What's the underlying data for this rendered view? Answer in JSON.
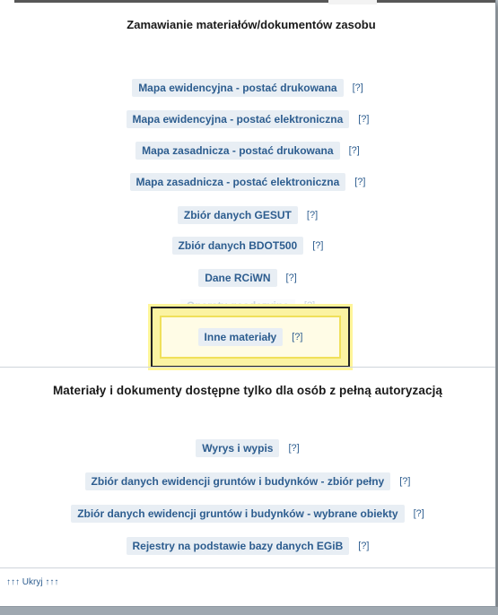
{
  "dialog": {
    "title": "Zamawianie materiałów/dokumentów zasobu",
    "public_items": [
      {
        "label": "Mapa ewidencyjna - postać drukowana",
        "help": "[?]"
      },
      {
        "label": "Mapa ewidencyjna - postać elektroniczna",
        "help": "[?]"
      },
      {
        "label": "Mapa zasadnicza - postać drukowana",
        "help": "[?]"
      },
      {
        "label": "Mapa zasadnicza - postać elektroniczna",
        "help": "[?]"
      },
      {
        "label": "Zbiór danych GESUT",
        "help": "[?]"
      },
      {
        "label": "Zbiór danych BDOT500",
        "help": "[?]"
      },
      {
        "label": "Dane RCiWN",
        "help": "[?]"
      }
    ],
    "faded_item": {
      "label": "Operaty geodezyjne",
      "help": "[?]"
    },
    "highlighted_item": {
      "label": "Inne materiały",
      "help": "[?]"
    },
    "authorized_section_title": "Materiały i dokumenty dostępne tylko dla osób z pełną autoryzacją",
    "authorized_items": [
      {
        "label": "Wyrys i wypis",
        "help": "[?]"
      },
      {
        "label": "Zbiór danych ewidencji gruntów i budynków - zbiór pełny",
        "help": "[?]"
      },
      {
        "label": "Zbiór danych ewidencji gruntów i budynków - wybrane obiekty",
        "help": "[?]"
      },
      {
        "label": "Rejestry na podstawie bazy danych EGiB",
        "help": "[?]"
      }
    ],
    "hide_link": "↑↑↑ Ukryj ↑↑↑"
  },
  "colors": {
    "link": "#2d5d8f",
    "button_bg": "#e8eef4",
    "highlight_fill": "#fbf3a2",
    "highlight_border": "#222222"
  }
}
